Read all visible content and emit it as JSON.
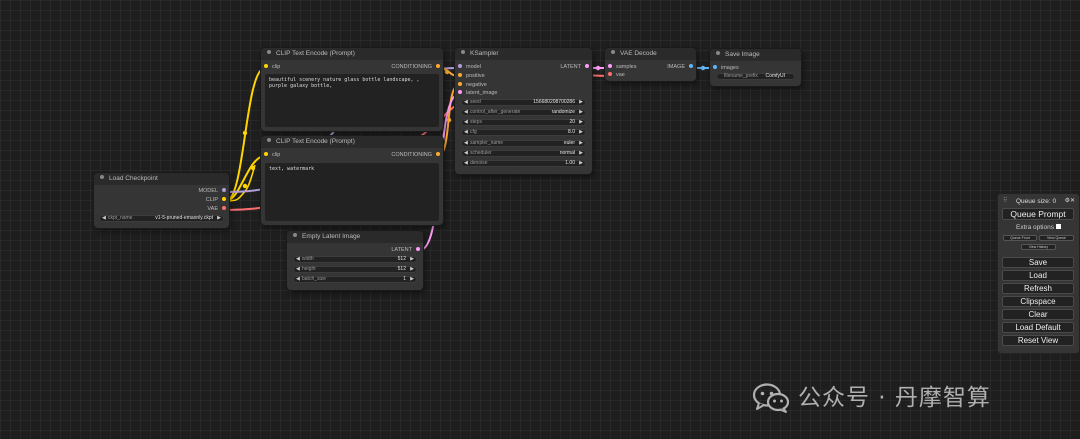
{
  "nodes": {
    "clip_text_positive": {
      "title": "CLIP Text Encode (Prompt)",
      "input": "clip",
      "output": "CONDITIONING",
      "text": "beautiful scenery nature glass bottle landscape, , purple galaxy bottle,"
    },
    "clip_text_negative": {
      "title": "CLIP Text Encode (Prompt)",
      "input": "clip",
      "output": "CONDITIONING",
      "text": "text, watermark"
    },
    "ksampler": {
      "title": "KSampler",
      "inputs": [
        "model",
        "positive",
        "negative",
        "latent_image"
      ],
      "output": "LATENT",
      "widgets": [
        {
          "label": "seed",
          "value": "156680208700286"
        },
        {
          "label": "control_after_generate",
          "value": "randomize"
        },
        {
          "label": "steps",
          "value": "20"
        },
        {
          "label": "cfg",
          "value": "8.0"
        },
        {
          "label": "sampler_name",
          "value": "euler"
        },
        {
          "label": "scheduler",
          "value": "normal"
        },
        {
          "label": "denoise",
          "value": "1.00"
        }
      ]
    },
    "vae_decode": {
      "title": "VAE Decode",
      "inputs": [
        "samples",
        "vae"
      ],
      "output": "IMAGE"
    },
    "save_image": {
      "title": "Save Image",
      "input": "images",
      "widget": {
        "label": "filename_prefix",
        "value": "ComfyUI"
      }
    },
    "load_checkpoint": {
      "title": "Load Checkpoint",
      "outputs": [
        "MODEL",
        "CLIP",
        "VAE"
      ],
      "widget": {
        "label": "ckpt_name",
        "value": "v1-5-pruned-emaonly.ckpt"
      }
    },
    "empty_latent": {
      "title": "Empty Latent Image",
      "output": "LATENT",
      "widgets": [
        {
          "label": "width",
          "value": "512"
        },
        {
          "label": "height",
          "value": "512"
        },
        {
          "label": "batch_size",
          "value": "1"
        }
      ]
    }
  },
  "panel": {
    "queue_size": "Queue size: 0",
    "queue_prompt": "Queue Prompt",
    "extra_options": "Extra options",
    "queue_front": "Queue Front",
    "view_queue": "View Queue",
    "view_history": "View History",
    "buttons": [
      "Save",
      "Load",
      "Refresh",
      "Clipspace",
      "Clear",
      "Load Default",
      "Reset View"
    ]
  },
  "watermark": {
    "text": "公众号 · 丹摩智算"
  },
  "colors": {
    "clip": "#ffd500",
    "model": "#b39ddb",
    "vae": "#ff6e6e",
    "conditioning": "#ffa931",
    "latent": "#ff9cf9",
    "image": "#64b5f6"
  }
}
